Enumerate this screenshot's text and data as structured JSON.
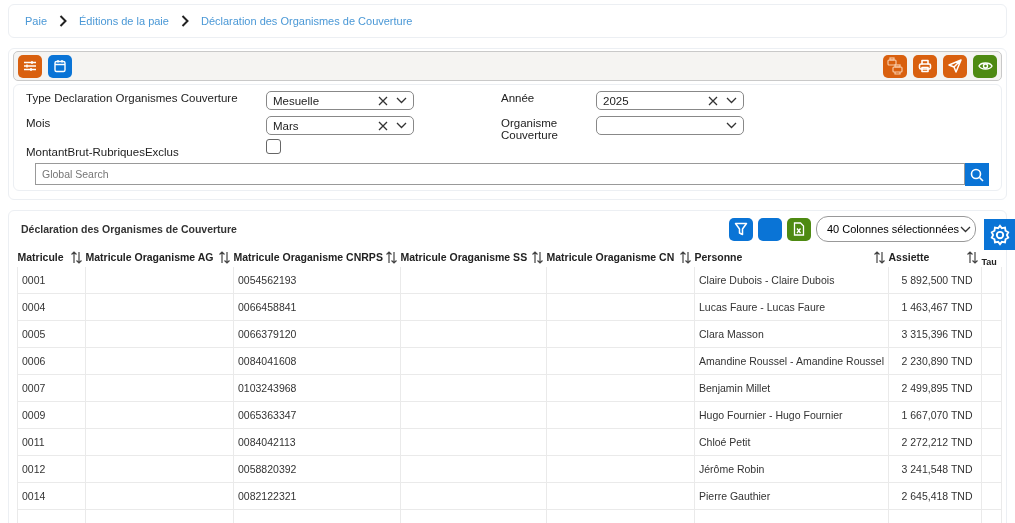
{
  "breadcrumb": [
    {
      "label": "Paie"
    },
    {
      "label": "Éditions de la paie"
    },
    {
      "label": "Déclaration des Organismes de Couverture"
    }
  ],
  "toolbar": {
    "left": [
      {
        "kind": "settings",
        "color": "#d9600f"
      },
      {
        "kind": "calendar",
        "color": "#0a74d6"
      }
    ],
    "right": [
      {
        "kind": "batch-print",
        "color": "#d9600f"
      },
      {
        "kind": "print",
        "color": "#d9600f"
      },
      {
        "kind": "send",
        "color": "#d9600f"
      },
      {
        "kind": "preview",
        "color": "#4e8a12"
      }
    ]
  },
  "filters": [
    {
      "label": "Type Declaration Organismes Couverture",
      "value": "Mesuelle",
      "clearable": true
    },
    {
      "label": "Année",
      "value": "2025",
      "clearable": true
    },
    {
      "label": "Mois",
      "value": "Mars",
      "clearable": true
    },
    {
      "label": "Organisme Couverture",
      "clearable": false
    }
  ],
  "checkbox": {
    "label": "MontantBrut-RubriquesExclus",
    "checked": false
  },
  "search": {
    "placeholder": "Global Search"
  },
  "table": {
    "title": "Déclaration des Organismes de Couverture",
    "actions": [
      {
        "kind": "filter",
        "color": "#0a74d6"
      },
      {
        "kind": "blank",
        "color": "#0a74d6"
      },
      {
        "kind": "excel",
        "color": "#4e8a12"
      }
    ],
    "column_select": "40 Colonnes sélectionnées",
    "columns": [
      {
        "label": "Matricule",
        "sortable": true
      },
      {
        "label": "Matricule Oraganisme AG",
        "sortable": true
      },
      {
        "label": "Matricule Oraganisme CNRPS",
        "sortable": true
      },
      {
        "label": "Matricule Oraganisme SS",
        "sortable": true
      },
      {
        "label": "Matricule Oraganisme CN",
        "sortable": true
      },
      {
        "label": "Personne",
        "sortable": true
      },
      {
        "label": "Assiette",
        "sortable": true
      },
      {
        "label": "Tau",
        "sortable": false
      }
    ],
    "rows": [
      [
        "0001",
        null,
        "0054562193",
        null,
        null,
        "Claire Dubois - Claire Dubois",
        "5 892,500 TND",
        null
      ],
      [
        "0004",
        null,
        "0066458841",
        null,
        null,
        "Lucas Faure - Lucas Faure",
        "1 463,467 TND",
        null
      ],
      [
        "0005",
        null,
        "0066379120",
        null,
        null,
        "Clara Masson",
        "3 315,396 TND",
        null
      ],
      [
        "0006",
        null,
        "0084041608",
        null,
        null,
        "Amandine Roussel - Amandine Roussel",
        "2 230,890 TND",
        null
      ],
      [
        "0007",
        null,
        "0103243968",
        null,
        null,
        "Benjamin Millet",
        "2 499,895 TND",
        null
      ],
      [
        "0009",
        null,
        "0065363347",
        null,
        null,
        "Hugo Fournier - Hugo Fournier",
        "1 667,070 TND",
        null
      ],
      [
        "0011",
        null,
        "0084042113",
        null,
        null,
        "Chloé Petit",
        "2 272,212 TND",
        null
      ],
      [
        "0012",
        null,
        "0058820392",
        null,
        null,
        "Jérôme Robin",
        "3 241,548 TND",
        null
      ],
      [
        "0014",
        null,
        "0082122321",
        null,
        null,
        "Pierre Gauthier",
        "2 645,418 TND",
        null
      ],
      []
    ]
  }
}
